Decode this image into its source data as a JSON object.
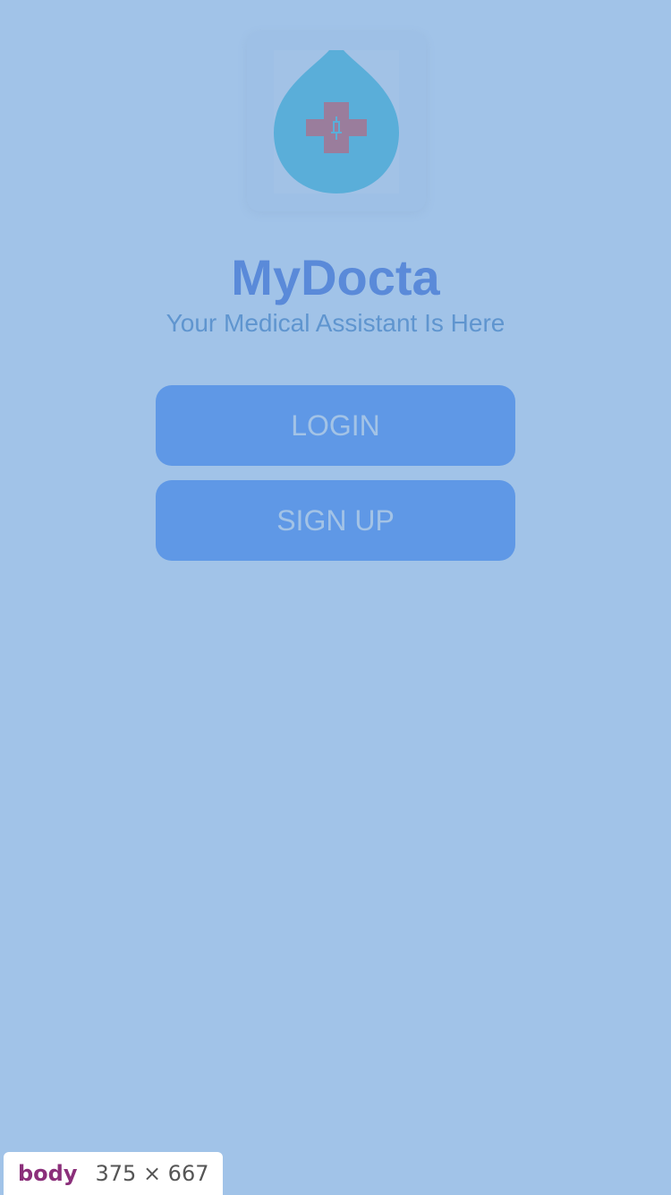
{
  "logo": {
    "icon": "blood-drop-medical-cross-syringe-icon",
    "colors": {
      "drop": "#5aaed9",
      "cross": "#9a7d9c",
      "syringe": "#5aaed9"
    }
  },
  "app": {
    "title": "MyDocta",
    "tagline": "Your Medical Assistant Is Here"
  },
  "buttons": {
    "login_label": "LOGIN",
    "signup_label": "SIGN UP"
  },
  "inspector": {
    "tag": "body",
    "size": "375 × 667"
  },
  "colors": {
    "background": "#a1c3e8",
    "title": "#5a8ad9",
    "tagline": "#5f95cf",
    "button": "#5f98e6",
    "button_text": "#a3c3e6"
  }
}
